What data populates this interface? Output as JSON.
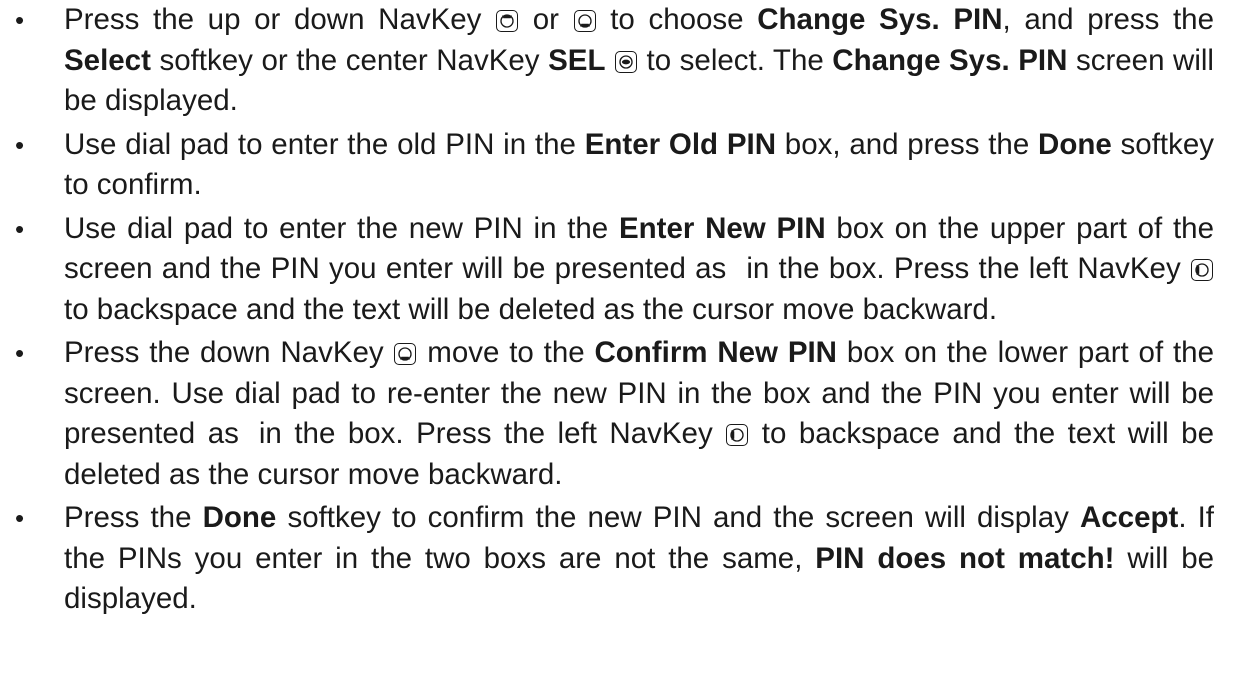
{
  "instructions": {
    "i1": {
      "a": "Press the up or down NavKey",
      "b": "or",
      "c": "to choose",
      "d": "Change Sys. PIN",
      "e": ", and press the",
      "f": "Select",
      "g": "softkey or the center NavKey",
      "h": "SEL",
      "i": "to select. The",
      "j": "Change Sys. PIN",
      "k": "screen will be displayed."
    },
    "i2": {
      "a": "Use dial pad to enter the old PIN in the",
      "b": "Enter Old PIN",
      "c": "box, and press the",
      "d": "Done",
      "e": "softkey to confirm."
    },
    "i3": {
      "a": "Use dial pad to enter the new PIN in the",
      "b": "Enter New PIN",
      "c": "box on the upper part of the screen and the PIN you enter will be presented as",
      "d": "in the box. Press the left NavKey",
      "e": "to backspace and the text will be deleted as the cursor move backward."
    },
    "i4": {
      "a": "Press the down NavKey",
      "b": "move to the",
      "c": "Confirm New PIN",
      "d": "box on the lower part of the screen. Use dial pad to re-enter the new PIN in the box and the PIN you enter will be presented as",
      "e": "in the box. Press the left NavKey",
      "f": "to backspace and the text will be deleted as the cursor move backward."
    },
    "i5": {
      "a": "Press the",
      "b": "Done",
      "c": "softkey to confirm the new PIN and the screen will display",
      "d": "Accept",
      "e": ". If the PINs you enter in the two boxs are not the same,",
      "f": "PIN does not match!",
      "g": "will be displayed."
    }
  },
  "icons": {
    "nav_up": "navkey-up-icon",
    "nav_down": "navkey-down-icon",
    "nav_center": "navkey-center-icon",
    "nav_left": "navkey-left-icon"
  }
}
